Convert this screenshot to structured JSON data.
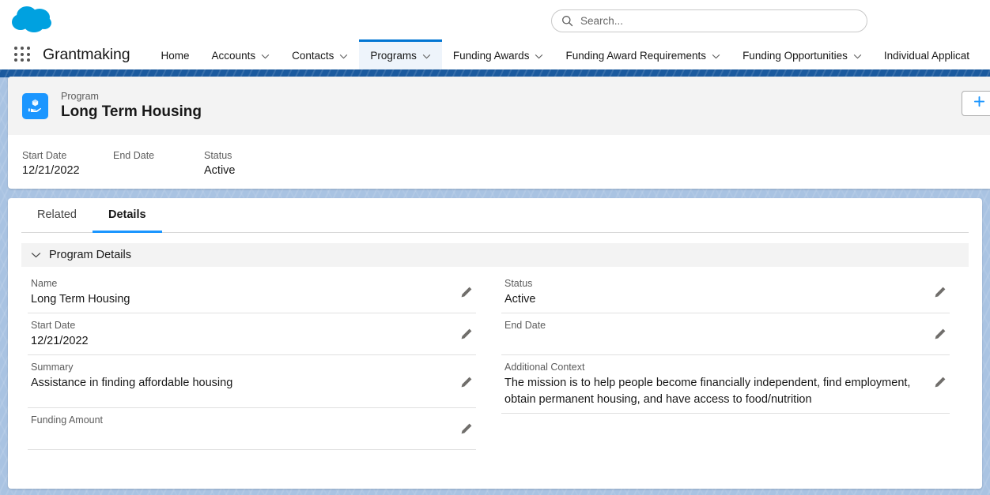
{
  "header": {
    "logo_icon": "salesforce-cloud-logo",
    "app_launcher_icon": "app-launcher-waffle-icon",
    "app_name": "Grantmaking",
    "search": {
      "icon": "search-icon",
      "placeholder": "Search..."
    },
    "nav_items": [
      {
        "label": "Home",
        "has_chevron": false,
        "active": false
      },
      {
        "label": "Accounts",
        "has_chevron": true,
        "active": false
      },
      {
        "label": "Contacts",
        "has_chevron": true,
        "active": false
      },
      {
        "label": "Programs",
        "has_chevron": true,
        "active": true
      },
      {
        "label": "Funding Awards",
        "has_chevron": true,
        "active": false
      },
      {
        "label": "Funding Award Requirements",
        "has_chevron": true,
        "active": false
      },
      {
        "label": "Funding Opportunities",
        "has_chevron": true,
        "active": false
      },
      {
        "label": "Individual Applicat",
        "has_chevron": false,
        "active": false
      }
    ]
  },
  "record": {
    "icon": "program-box-in-hand-icon",
    "object_label": "Program",
    "title": "Long Term Housing",
    "new_button_icon": "plus-icon",
    "highlights": [
      {
        "label": "Start Date",
        "value": "12/21/2022"
      },
      {
        "label": "End Date",
        "value": ""
      },
      {
        "label": "Status",
        "value": "Active"
      }
    ]
  },
  "details": {
    "tabs": [
      {
        "label": "Related",
        "active": false
      },
      {
        "label": "Details",
        "active": true
      }
    ],
    "section": {
      "title": "Program Details",
      "collapse_icon": "chevron-down-icon"
    },
    "left_fields": [
      {
        "label": "Name",
        "value": "Long Term Housing",
        "edit_icon": "pencil-icon"
      },
      {
        "label": "Start Date",
        "value": "12/21/2022",
        "edit_icon": "pencil-icon"
      },
      {
        "label": "Summary",
        "value": "Assistance in finding affordable housing",
        "edit_icon": "pencil-icon"
      },
      {
        "label": "Funding Amount",
        "value": "",
        "edit_icon": "pencil-icon"
      }
    ],
    "right_fields": [
      {
        "label": "Status",
        "value": "Active",
        "edit_icon": "pencil-icon"
      },
      {
        "label": "End Date",
        "value": "",
        "edit_icon": "pencil-icon"
      },
      {
        "label": "Additional Context",
        "value": "The mission is to help people become financially independent, find employment, obtain permanent housing, and have access to food/nutrition",
        "edit_icon": "pencil-icon"
      }
    ]
  },
  "colors": {
    "brand_blue": "#0176d3",
    "logo_blue": "#00a1e0",
    "icon_blue": "#1b96ff",
    "page_bg": "#a9c3e2",
    "active_tab_underline": "#1b96ff"
  }
}
